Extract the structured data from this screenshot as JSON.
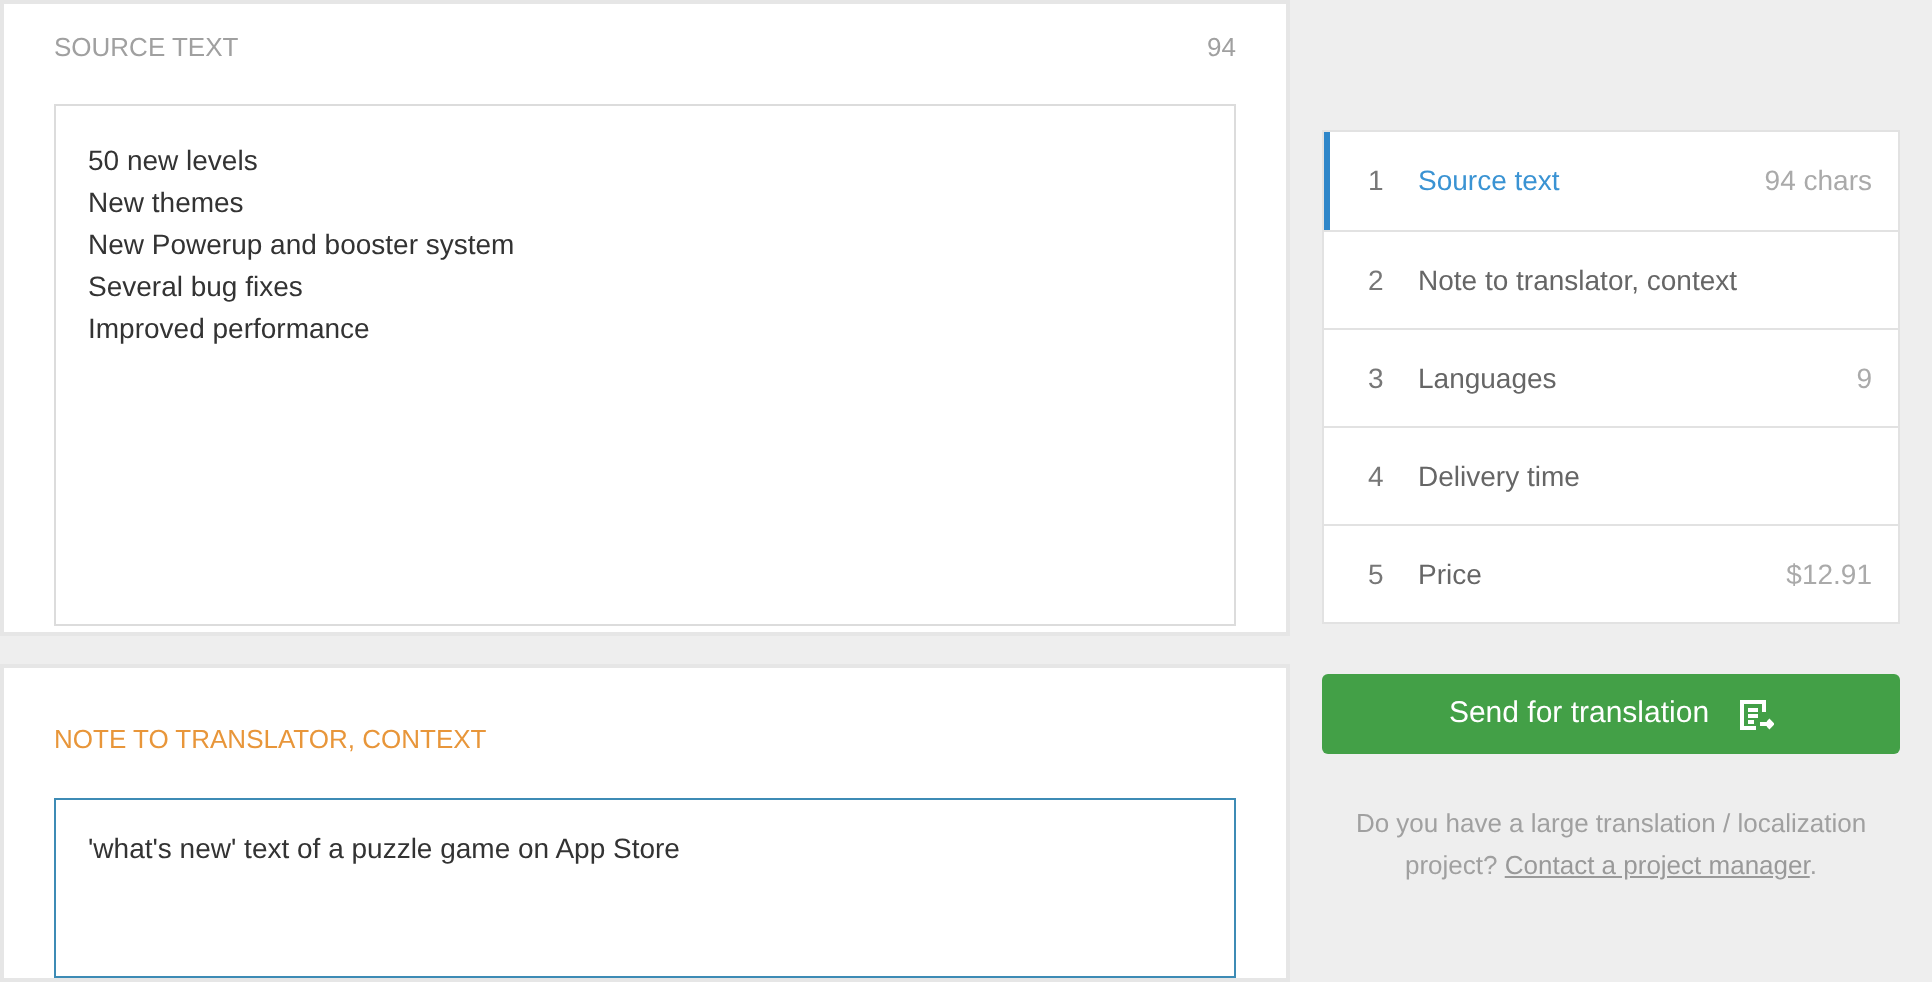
{
  "source_text": {
    "heading": "SOURCE TEXT",
    "count": "94",
    "lines": [
      "50 new levels",
      "New themes",
      "New Powerup and booster system",
      "Several bug fixes",
      "Improved performance"
    ]
  },
  "note": {
    "heading": "NOTE TO TRANSLATOR, CONTEXT",
    "value": "'what's new' text of a puzzle game on App Store",
    "focused": true
  },
  "steps": [
    {
      "number": "1",
      "label": "Source text",
      "value": "94 chars",
      "selected": true
    },
    {
      "number": "2",
      "label": "Note to translator, context",
      "selected": false
    },
    {
      "number": "3",
      "label": "Languages",
      "value": "9",
      "selected": false
    },
    {
      "number": "4",
      "label": "Delivery time",
      "selected": false
    },
    {
      "number": "5",
      "label": "Price",
      "value": "$12.91",
      "selected": false
    }
  ],
  "send_button": "Send for translation",
  "footer": {
    "text": "Do you have a large translation / localization project?",
    "link": "Contact a project manager",
    "after": "."
  }
}
